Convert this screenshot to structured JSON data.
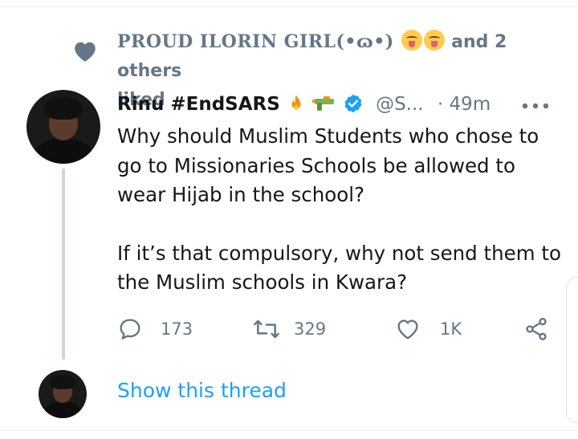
{
  "social_context": {
    "liker_name": "PROUD ILORIN GIRL(",
    "liker_name_glyphs": "•ɷ•",
    "liker_name_close": ")",
    "others_text": "and 2 others",
    "liked_text": "liked",
    "icon": "heart-icon",
    "emojis": [
      "yum-face-emoji",
      "yum-face-emoji"
    ]
  },
  "tweet": {
    "author_name": "Rinu #EndSARS",
    "author_emojis": [
      "fire-icon",
      "water-gun-icon"
    ],
    "verified": true,
    "handle": "@S...",
    "separator": "·",
    "time": "49m",
    "paragraphs": [
      "Why should Muslim Students who chose to go to Missionaries Schools be allowed to wear Hijab in the school?",
      "If it’s that compulsory, why not send them to the Muslim schools in Kwara?"
    ],
    "reply_count": "173",
    "retweet_count": "329",
    "like_count": "1K"
  },
  "show_thread_label": "Show this thread",
  "colors": {
    "accent": "#1da1f2",
    "muted": "#657786",
    "text": "#14171a",
    "thread_line": "#ccd6dd"
  }
}
